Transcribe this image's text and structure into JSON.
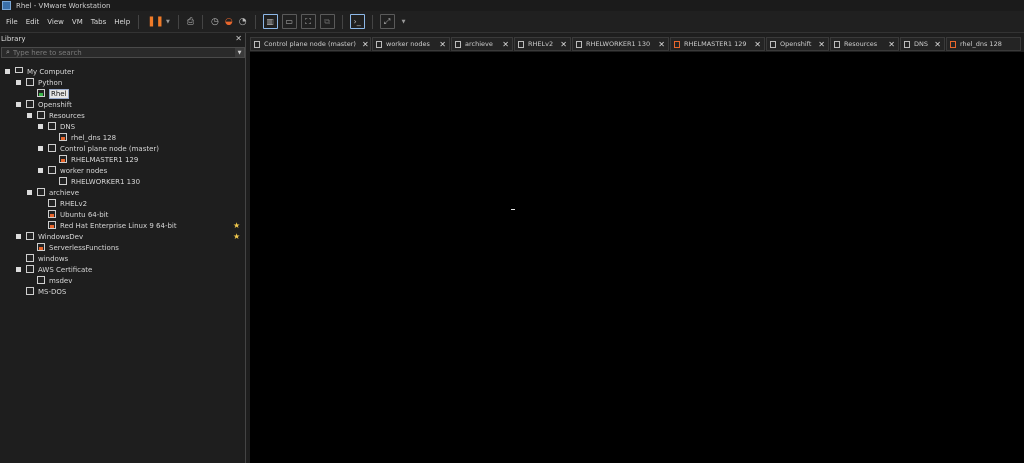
{
  "window": {
    "title": "Rhel - VMware Workstation"
  },
  "menu": [
    "File",
    "Edit",
    "View",
    "VM",
    "Tabs",
    "Help"
  ],
  "toolbar": {
    "pause_icon": "pause-icon",
    "accent": "#f07b28",
    "icons": [
      "send-keys-icon",
      "snapshot-icon",
      "revert-snapshot-icon",
      "manage-snapshots-icon",
      "show-library-icon",
      "thumbnail-icon",
      "full-screen-icon",
      "unity-icon",
      "console-view-icon",
      "stretch-icon"
    ]
  },
  "library": {
    "title": "Library",
    "close_glyph": "✕",
    "search_placeholder": "Type here to search",
    "tree": [
      {
        "label": "My Computer",
        "level": 0,
        "type": "computer",
        "expanded": true
      },
      {
        "label": "Python",
        "level": 1,
        "type": "folder",
        "expanded": true
      },
      {
        "label": "Rhel",
        "level": 2,
        "type": "vm-on",
        "selected": true
      },
      {
        "label": "Openshift",
        "level": 1,
        "type": "folder",
        "expanded": true
      },
      {
        "label": "Resources",
        "level": 2,
        "type": "folder",
        "expanded": true
      },
      {
        "label": "DNS",
        "level": 3,
        "type": "folder",
        "expanded": true
      },
      {
        "label": "rhel_dns 128",
        "level": 4,
        "type": "vm-off"
      },
      {
        "label": "Control plane node (master)",
        "level": 3,
        "type": "folder",
        "expanded": true
      },
      {
        "label": "RHELMASTER1 129",
        "level": 4,
        "type": "vm-off"
      },
      {
        "label": "worker nodes",
        "level": 3,
        "type": "folder",
        "expanded": true
      },
      {
        "label": "RHELWORKER1 130",
        "level": 4,
        "type": "vm"
      },
      {
        "label": "archieve",
        "level": 2,
        "type": "folder",
        "expanded": true
      },
      {
        "label": "RHELv2",
        "level": 3,
        "type": "vm"
      },
      {
        "label": "Ubuntu 64-bit",
        "level": 3,
        "type": "vm-off"
      },
      {
        "label": "Red Hat Enterprise Linux 9 64-bit",
        "level": 3,
        "type": "vm-off",
        "starred": true
      },
      {
        "label": "WindowsDev",
        "level": 1,
        "type": "folder",
        "expanded": true,
        "starred": true
      },
      {
        "label": "ServerlessFunctions",
        "level": 2,
        "type": "vm-off"
      },
      {
        "label": "windows",
        "level": 1,
        "type": "vm"
      },
      {
        "label": "AWS Certificate",
        "level": 1,
        "type": "folder",
        "expanded": true
      },
      {
        "label": "msdev",
        "level": 2,
        "type": "vm"
      },
      {
        "label": "MS-DOS",
        "level": 1,
        "type": "vm"
      }
    ]
  },
  "tabs": [
    {
      "label": "Control plane node (master)",
      "icon": "folder",
      "close": "✕"
    },
    {
      "label": "worker nodes",
      "icon": "folder",
      "close": "✕"
    },
    {
      "label": "archieve",
      "icon": "folder",
      "close": "✕"
    },
    {
      "label": "RHELv2",
      "icon": "vm",
      "close": "✕"
    },
    {
      "label": "RHELWORKER1 130",
      "icon": "vm",
      "close": "✕"
    },
    {
      "label": "RHELMASTER1 129",
      "icon": "vm-off",
      "close": "✕"
    },
    {
      "label": "Openshift",
      "icon": "folder",
      "close": "✕"
    },
    {
      "label": "Resources",
      "icon": "folder",
      "close": "✕"
    },
    {
      "label": "DNS",
      "icon": "folder",
      "close": "✕"
    },
    {
      "label": "rhel_dns 128",
      "icon": "vm-off",
      "close": ""
    }
  ]
}
